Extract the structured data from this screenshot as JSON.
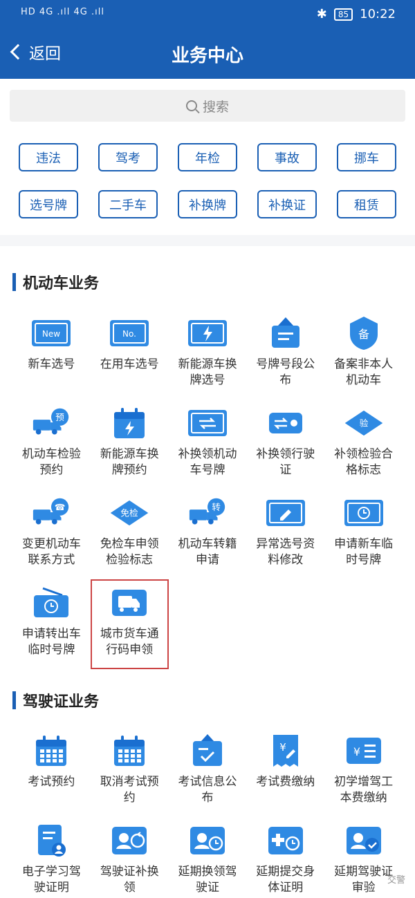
{
  "status_bar": {
    "left": "HD 4G .ıll 4G .ıll",
    "battery": "85",
    "time": "10:22"
  },
  "header": {
    "back_label": "返回",
    "title": "业务中心"
  },
  "search": {
    "placeholder": "搜索"
  },
  "quick_chips": [
    "违法",
    "驾考",
    "年检",
    "事故",
    "挪车",
    "选号牌",
    "二手车",
    "补换牌",
    "补换证",
    "租赁"
  ],
  "sections": [
    {
      "title": "机动车业务",
      "items": [
        {
          "label": "新车选号",
          "icon": "new-plate-icon"
        },
        {
          "label": "在用车选号",
          "icon": "no-plate-icon"
        },
        {
          "label": "新能源车换牌选号",
          "icon": "ev-plate-icon"
        },
        {
          "label": "号牌号段公布",
          "icon": "hanging-sign-icon"
        },
        {
          "label": "备案非本人机动车",
          "icon": "shield-record-icon"
        },
        {
          "label": "机动车检验预约",
          "icon": "truck-reserve-icon"
        },
        {
          "label": "新能源车换牌预约",
          "icon": "calendar-bolt-icon"
        },
        {
          "label": "补换领机动车号牌",
          "icon": "plate-swap-icon"
        },
        {
          "label": "补换领行驶证",
          "icon": "car-swap-icon"
        },
        {
          "label": "补领检验合格标志",
          "icon": "inspect-diamond-icon"
        },
        {
          "label": "变更机动车联系方式",
          "icon": "truck-phone-icon"
        },
        {
          "label": "免检车申领检验标志",
          "icon": "exempt-diamond-icon"
        },
        {
          "label": "机动车转籍申请",
          "icon": "truck-transfer-icon"
        },
        {
          "label": "异常选号资料修改",
          "icon": "plate-edit-icon"
        },
        {
          "label": "申请新车临时号牌",
          "icon": "plate-clock-icon"
        },
        {
          "label": "申请转出车临时号牌",
          "icon": "hanging-clock-icon"
        },
        {
          "label": "城市货车通行码申领",
          "icon": "truck-pass-icon",
          "highlighted": true
        }
      ]
    },
    {
      "title": "驾驶证业务",
      "items": [
        {
          "label": "考试预约",
          "icon": "calendar-grid-icon"
        },
        {
          "label": "取消考试预约",
          "icon": "calendar-grid-icon"
        },
        {
          "label": "考试信息公布",
          "icon": "board-check-icon"
        },
        {
          "label": "考试费缴纳",
          "icon": "receipt-yen-icon"
        },
        {
          "label": "初学增驾工本费缴纳",
          "icon": "yen-list-icon"
        },
        {
          "label": "电子学习驾驶证明",
          "icon": "document-user-icon"
        },
        {
          "label": "驾驶证补换领",
          "icon": "license-refresh-icon"
        },
        {
          "label": "延期换领驾驶证",
          "icon": "license-clock-icon"
        },
        {
          "label": "延期提交身体证明",
          "icon": "medical-clock-icon"
        },
        {
          "label": "延期驾驶证审验",
          "icon": "license-check-icon"
        }
      ]
    }
  ],
  "watermark": "交警",
  "colors": {
    "primary": "#1a5fb4",
    "icon_blue": "#2f8ae3",
    "highlight": "#c44444"
  }
}
